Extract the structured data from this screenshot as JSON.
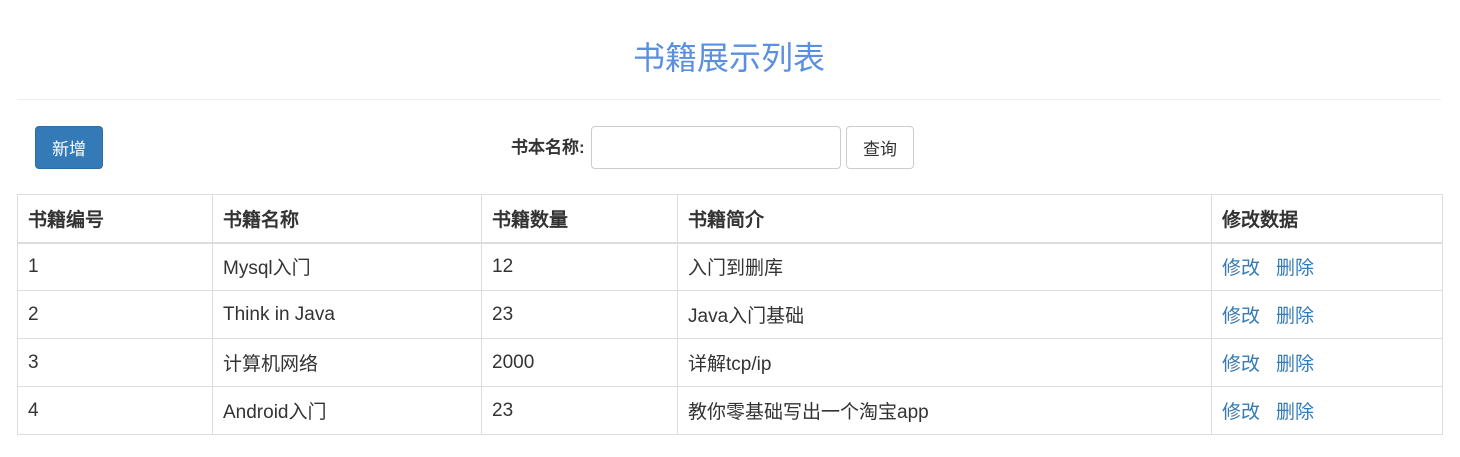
{
  "header": {
    "title": "书籍展示列表"
  },
  "toolbar": {
    "add_label": "新增",
    "search_label": "书本名称:",
    "search_value": "",
    "search_placeholder": "",
    "query_label": "查询"
  },
  "table": {
    "columns": [
      "书籍编号",
      "书籍名称",
      "书籍数量",
      "书籍简介",
      "修改数据"
    ],
    "rows": [
      {
        "id": "1",
        "name": "Mysql入门",
        "count": "12",
        "desc": "入门到删库",
        "edit": "修改",
        "delete": "删除"
      },
      {
        "id": "2",
        "name": "Think in Java",
        "count": "23",
        "desc": "Java入门基础",
        "edit": "修改",
        "delete": "删除"
      },
      {
        "id": "3",
        "name": "计算机网络",
        "count": "2000",
        "desc": "详解tcp/ip",
        "edit": "修改",
        "delete": "删除"
      },
      {
        "id": "4",
        "name": "Android入门",
        "count": "23",
        "desc": "教你零基础写出一个淘宝app",
        "edit": "修改",
        "delete": "删除"
      }
    ]
  },
  "colors": {
    "title": "#5b8fe0",
    "primary": "#337ab7",
    "link": "#337ab7",
    "border": "#dddddd"
  }
}
